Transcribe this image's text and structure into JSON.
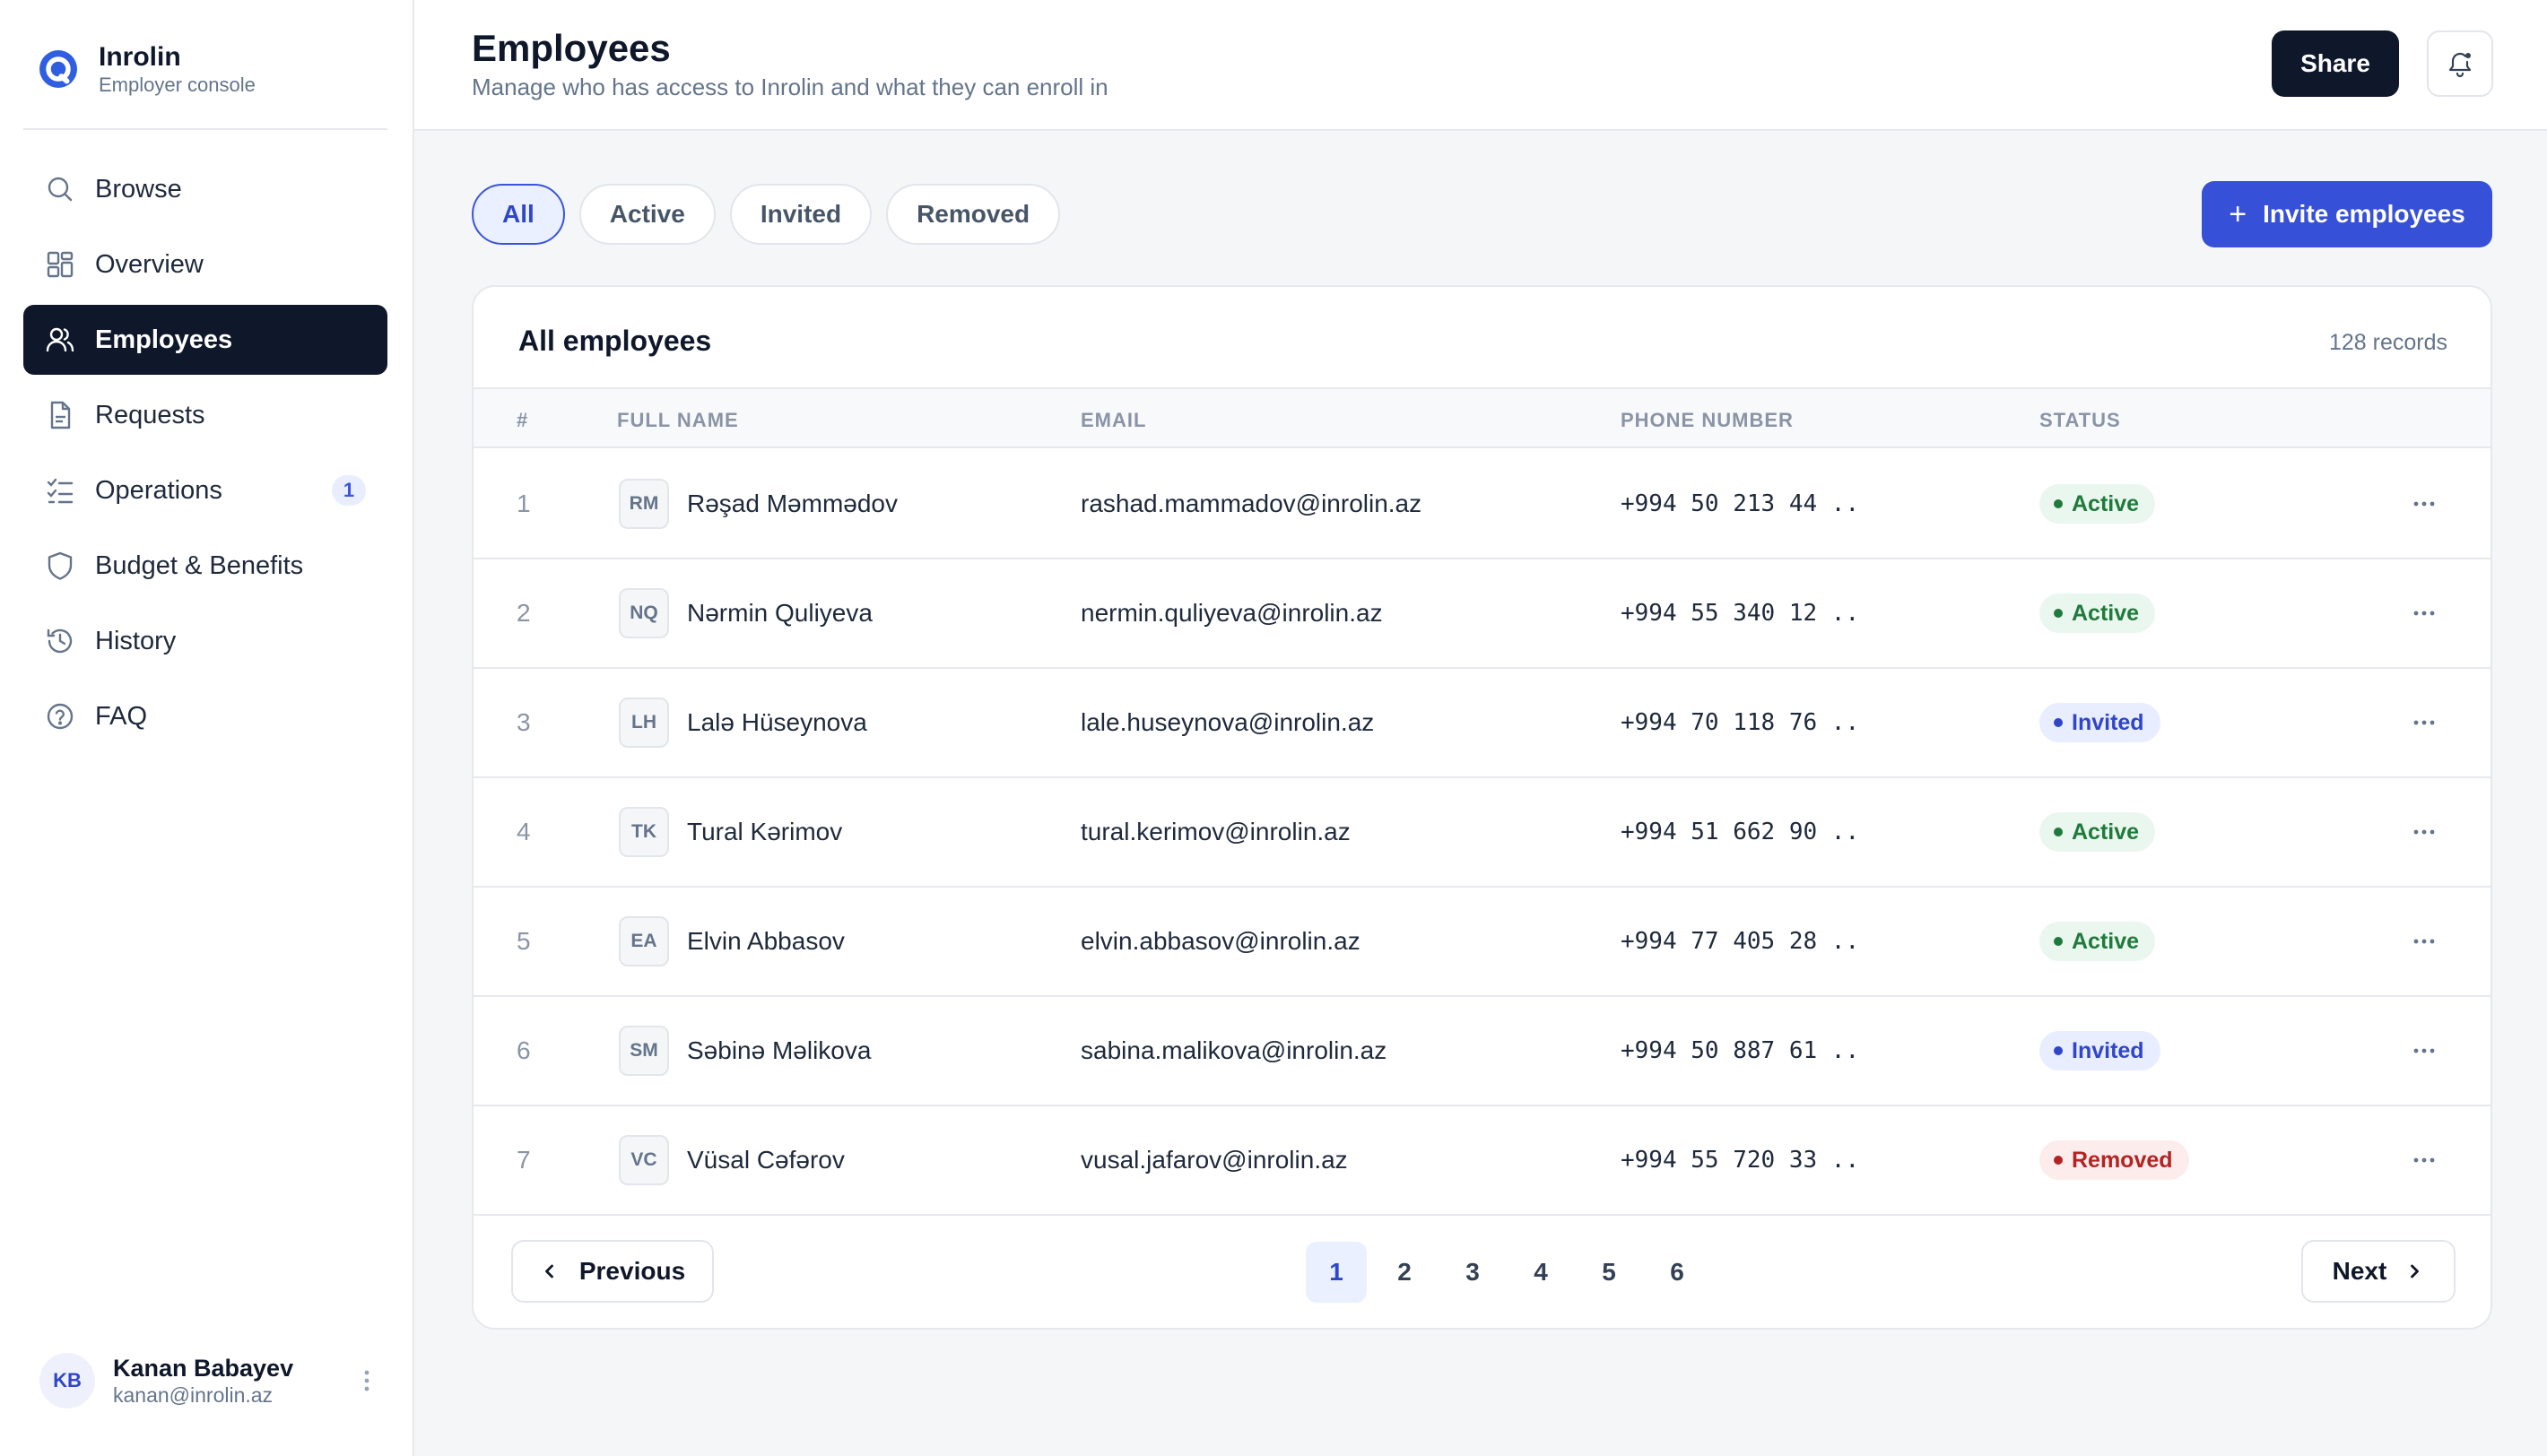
{
  "brand": {
    "name": "Inrolin",
    "subtitle": "Employer console"
  },
  "sidebar": {
    "items": [
      {
        "label": "Browse",
        "icon": "search-icon"
      },
      {
        "label": "Overview",
        "icon": "grid-icon"
      },
      {
        "label": "Employees",
        "icon": "users-icon",
        "active": true
      },
      {
        "label": "Requests",
        "icon": "document-icon"
      },
      {
        "label": "Operations",
        "icon": "list-check-icon",
        "badge": "1"
      },
      {
        "label": "Budget & Benefits",
        "icon": "shield-icon"
      },
      {
        "label": "History",
        "icon": "history-icon"
      },
      {
        "label": "FAQ",
        "icon": "help-circle-icon"
      }
    ]
  },
  "user": {
    "initials": "KB",
    "name": "Kanan Babayev",
    "email": "kanan@inrolin.az"
  },
  "header": {
    "title": "Employees",
    "subtitle": "Manage who has access to Inrolin and what they can enroll in",
    "share_label": "Share"
  },
  "filters": [
    {
      "label": "All",
      "active": true
    },
    {
      "label": "Active"
    },
    {
      "label": "Invited"
    },
    {
      "label": "Removed"
    }
  ],
  "invite_label": "Invite employees",
  "table": {
    "title": "All employees",
    "count": "128 records",
    "columns": [
      "#",
      "FULL NAME",
      "EMAIL",
      "PHONE NUMBER",
      "STATUS"
    ],
    "rows": [
      {
        "idx": "1",
        "initials": "RM",
        "name": "Rəşad Məmmədov",
        "email": "rashad.mammadov@inrolin.az",
        "phone": "+994 50 213 44 ..",
        "status": "Active",
        "status_key": "active"
      },
      {
        "idx": "2",
        "initials": "NQ",
        "name": "Nərmin Quliyeva",
        "email": "nermin.quliyeva@inrolin.az",
        "phone": "+994 55 340 12 ..",
        "status": "Active",
        "status_key": "active"
      },
      {
        "idx": "3",
        "initials": "LH",
        "name": "Lalə Hüseynova",
        "email": "lale.huseynova@inrolin.az",
        "phone": "+994 70 118 76 ..",
        "status": "Invited",
        "status_key": "invited"
      },
      {
        "idx": "4",
        "initials": "TK",
        "name": "Tural Kərimov",
        "email": "tural.kerimov@inrolin.az",
        "phone": "+994 51 662 90 ..",
        "status": "Active",
        "status_key": "active"
      },
      {
        "idx": "5",
        "initials": "EA",
        "name": "Elvin Abbasov",
        "email": "elvin.abbasov@inrolin.az",
        "phone": "+994 77 405 28 ..",
        "status": "Active",
        "status_key": "active"
      },
      {
        "idx": "6",
        "initials": "SM",
        "name": "Səbinə Məlikova",
        "email": "sabina.malikova@inrolin.az",
        "phone": "+994 50 887 61 ..",
        "status": "Invited",
        "status_key": "invited"
      },
      {
        "idx": "7",
        "initials": "VC",
        "name": "Vüsal Cəfərov",
        "email": "vusal.jafarov@inrolin.az",
        "phone": "+994 55 720 33 ..",
        "status": "Removed",
        "status_key": "removed"
      }
    ]
  },
  "pagination": {
    "prev_label": "Previous",
    "next_label": "Next",
    "pages": [
      "1",
      "2",
      "3",
      "4",
      "5",
      "6"
    ],
    "current": "1"
  },
  "colors": {
    "primary": "#3650d8",
    "dark": "#0f172a",
    "active": "#1f7a3c",
    "invited": "#2f46c9",
    "removed": "#b42323"
  }
}
